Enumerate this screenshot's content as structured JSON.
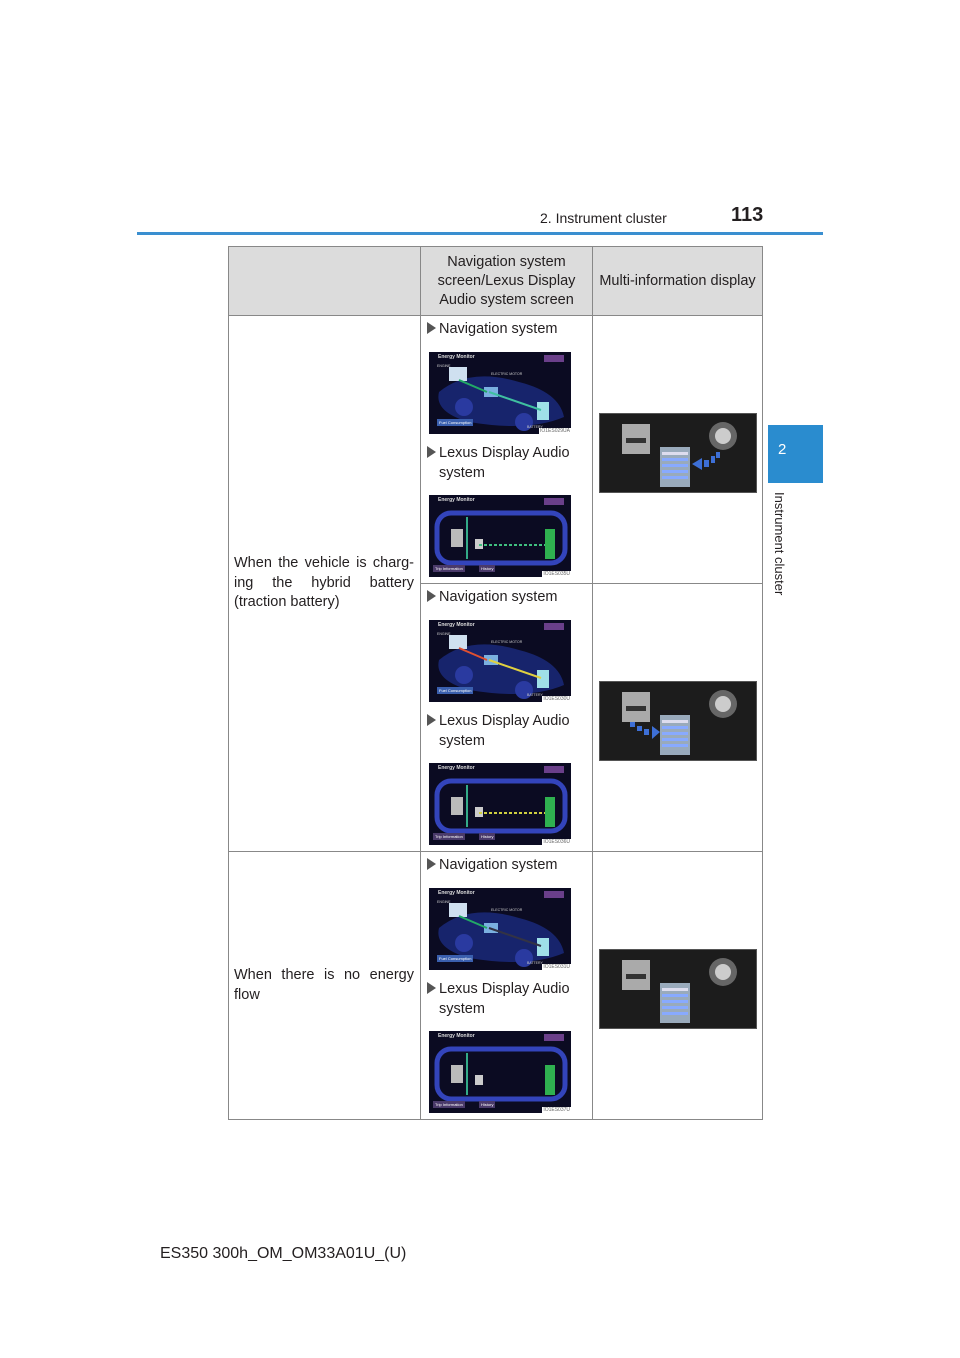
{
  "header": {
    "section": "2. Instrument cluster",
    "page_number": "113"
  },
  "side_tab": {
    "number": "2",
    "label": "Instrument cluster"
  },
  "table": {
    "headers": [
      "",
      "Navigation system screen/Lexus Display Audio system screen",
      "Multi-information display"
    ],
    "rows": [
      {
        "condition": "When the vehicle is charg-ing the hybrid battery (traction battery)",
        "nav_label": "Navigation system",
        "nav_code": "IO1ES029UA",
        "lda_label": "Lexus Display Audio system",
        "lda_code": "IO1ES035U",
        "flow": "wheel-to-battery"
      },
      {
        "condition": "",
        "nav_label": "Navigation system",
        "nav_code": "IO1ES030U",
        "lda_label": "Lexus Display Audio system",
        "lda_code": "IO1ES036U",
        "flow": "engine-to-battery"
      },
      {
        "condition": "When there is no energy flow",
        "nav_label": "Navigation system",
        "nav_code": "IO1ES031U",
        "lda_label": "Lexus Display Audio system",
        "lda_code": "IO1ES037U",
        "flow": "none"
      }
    ]
  },
  "screen_text": {
    "title": "Energy Monitor",
    "engine": "ENGINE",
    "motor": "ELECTRIC MOTOR",
    "battery": "BATTERY",
    "fuel_btn": "Fuel Consumption",
    "trip_btn": "Trip Information",
    "history_btn": "History"
  },
  "colors": {
    "accent": "#2a8ccf",
    "flow_arrow": "#3d6fd6"
  },
  "footer": "ES350 300h_OM_OM33A01U_(U)"
}
